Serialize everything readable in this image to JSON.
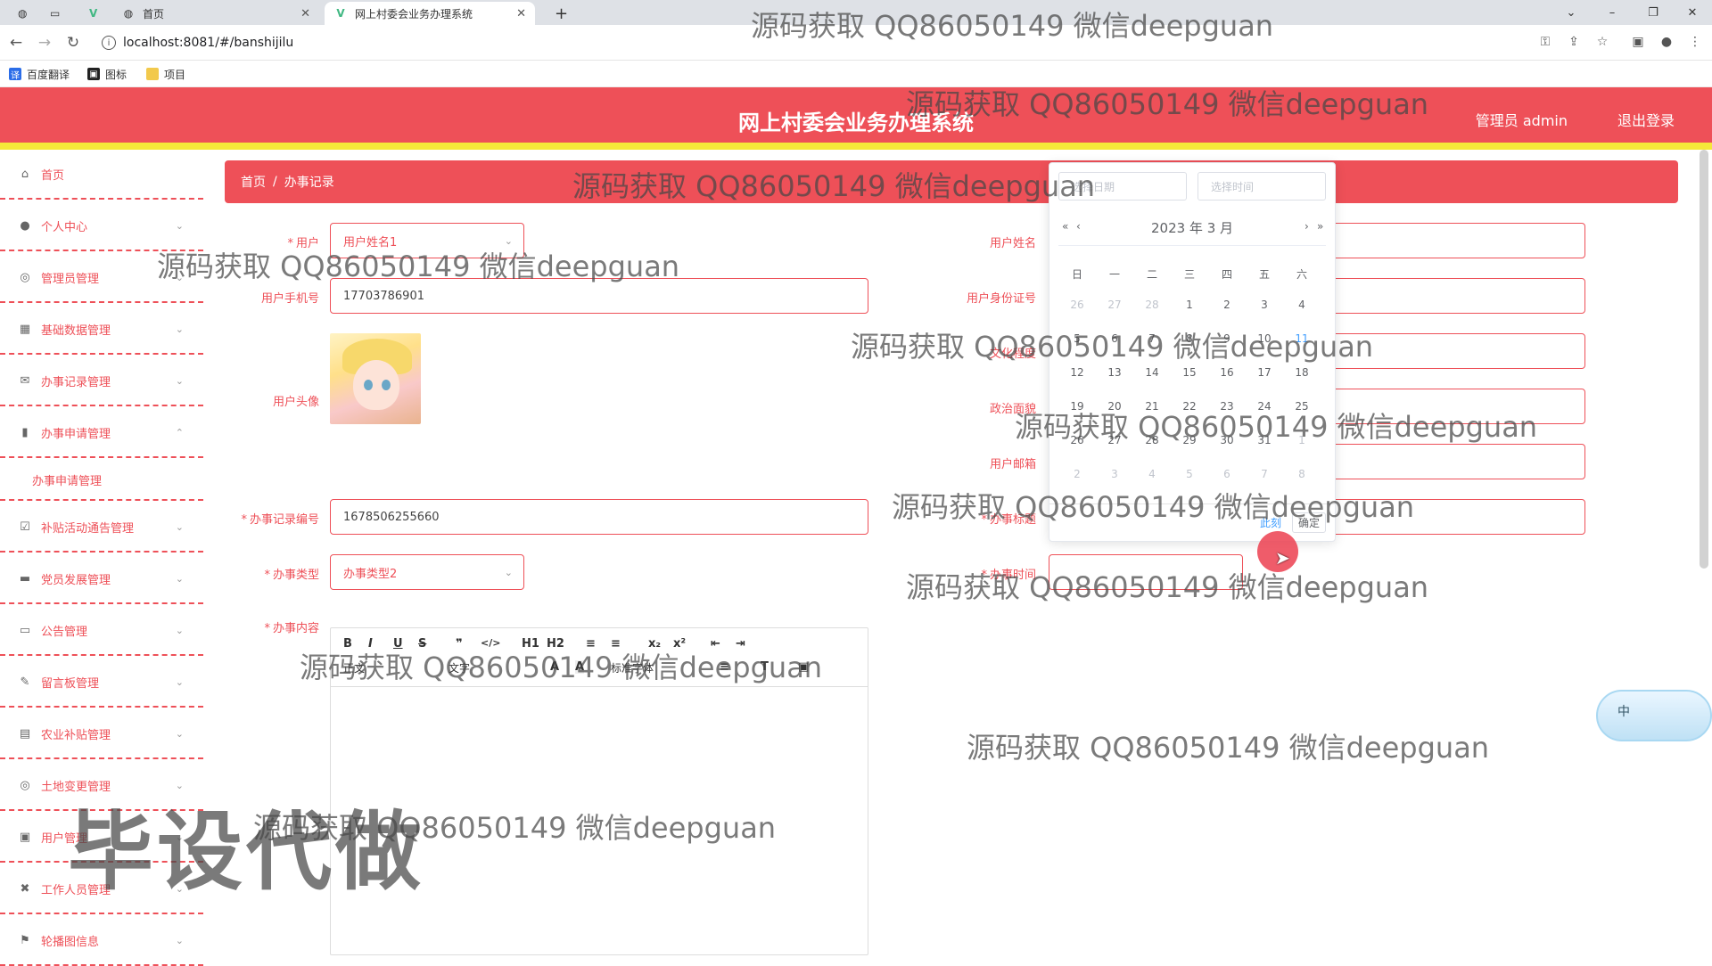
{
  "browser": {
    "tabs": [
      {
        "label": "首页"
      },
      {
        "label": "网上村委会业务办理系统"
      }
    ],
    "url": "localhost:8081/#/banshijilu",
    "bookmarks": [
      "百度翻译",
      "图标",
      "项目"
    ]
  },
  "header": {
    "title": "网上村委会业务办理系统",
    "user_label": "管理员 admin",
    "logout_label": "退出登录",
    "brand_color": "#ee5058",
    "accent_color": "#f5e83a"
  },
  "sidebar": {
    "items": [
      {
        "label": "首页",
        "icon": "home-icon"
      },
      {
        "label": "个人中心",
        "icon": "user-icon"
      },
      {
        "label": "管理员管理",
        "icon": "admin-icon"
      },
      {
        "label": "基础数据管理",
        "icon": "grid-icon"
      },
      {
        "label": "办事记录管理",
        "icon": "mail-icon"
      },
      {
        "label": "办事申请管理",
        "icon": "apply-icon",
        "expanded": true
      },
      {
        "label": "办事申请管理",
        "icon": "",
        "sub": true
      },
      {
        "label": "补贴活动通告管理",
        "icon": "notice-icon"
      },
      {
        "label": "党员发展管理",
        "icon": "monitor-icon"
      },
      {
        "label": "公告管理",
        "icon": "chat-icon"
      },
      {
        "label": "留言板管理",
        "icon": "message-icon"
      },
      {
        "label": "农业补贴管理",
        "icon": "clipboard-icon"
      },
      {
        "label": "土地变更管理",
        "icon": "land-icon"
      },
      {
        "label": "用户管理",
        "icon": "users-icon"
      },
      {
        "label": "工作人员管理",
        "icon": "staff-icon"
      },
      {
        "label": "轮播图信息",
        "icon": "flag-icon"
      }
    ]
  },
  "breadcrumb": {
    "home": "首页",
    "current": "办事记录"
  },
  "form": {
    "user_label": "用户",
    "user_value": "用户姓名1",
    "phone_label": "用户手机号",
    "phone_value": "17703786901",
    "avatar_label": "用户头像",
    "record_no_label": "办事记录编号",
    "record_no_value": "1678506255660",
    "type_label": "办事类型",
    "type_value": "办事类型2",
    "content_label": "办事内容",
    "name_label": "用户姓名",
    "id_label": "用户身份证号",
    "edu_label": "文化程度",
    "politics_label": "政治面貌",
    "email_label": "用户邮箱",
    "title_label": "办事标题",
    "time_label": "办事时间"
  },
  "editor": {
    "toolbar_row1": [
      "B",
      "I",
      "U",
      "S",
      "❞",
      "</>",
      "H1",
      "H2",
      "≡",
      "≡",
      "x₂",
      "x²",
      "⇤",
      "⇥"
    ],
    "toolbar_row2": [
      "正文",
      "文字",
      "A",
      "A",
      "标准字体",
      "≡",
      "T",
      "▣"
    ]
  },
  "datepicker": {
    "date_placeholder": "选择日期",
    "time_placeholder": "选择时间",
    "header": "2023 年  3 月",
    "weekdays": [
      "日",
      "一",
      "二",
      "三",
      "四",
      "五",
      "六"
    ],
    "weeks": [
      [
        "26",
        "27",
        "28",
        "1",
        "2",
        "3",
        "4"
      ],
      [
        "5",
        "6",
        "7",
        "8",
        "9",
        "10",
        "11"
      ],
      [
        "12",
        "13",
        "14",
        "15",
        "16",
        "17",
        "18"
      ],
      [
        "19",
        "20",
        "21",
        "22",
        "23",
        "24",
        "25"
      ],
      [
        "26",
        "27",
        "28",
        "29",
        "30",
        "31",
        "1"
      ],
      [
        "2",
        "3",
        "4",
        "5",
        "6",
        "7",
        "8"
      ]
    ],
    "now_label": "此刻",
    "confirm_label": "确定"
  },
  "ime": {
    "label": "中"
  },
  "watermarks": {
    "text": "源码获取 QQ86050149 微信deepguan",
    "big": "毕设代做"
  }
}
